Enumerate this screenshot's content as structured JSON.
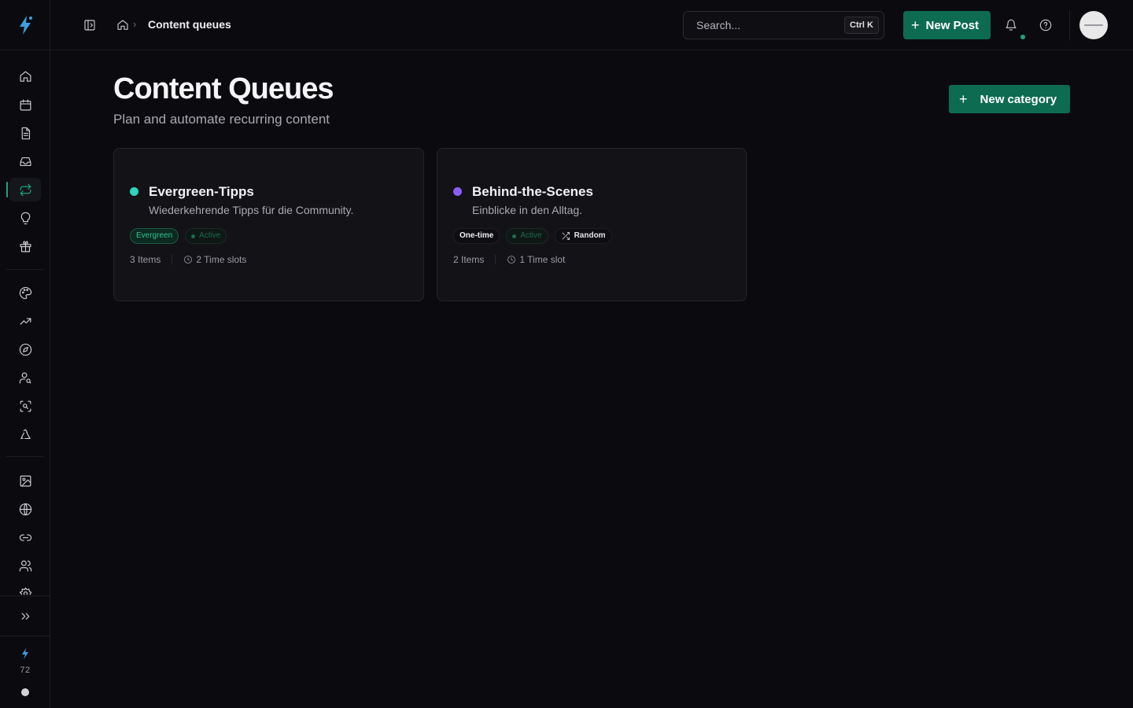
{
  "app": {
    "logo_icon": "lightning-bolt-icon",
    "accent": "#1ea37a",
    "button_color": "#0d6b52"
  },
  "header": {
    "breadcrumb_current": "Content queues",
    "search_placeholder": "Search...",
    "search_shortcut": "Ctrl K",
    "new_post_label": "New Post"
  },
  "sidebar": {
    "items": [
      {
        "icon": "home-icon"
      },
      {
        "icon": "calendar-icon"
      },
      {
        "icon": "document-icon"
      },
      {
        "icon": "inbox-icon"
      },
      {
        "icon": "repeat-icon",
        "active": true
      },
      {
        "icon": "lightbulb-icon"
      },
      {
        "icon": "gift-icon"
      },
      {
        "icon": "palette-icon"
      },
      {
        "icon": "trending-up-icon"
      },
      {
        "icon": "compass-icon"
      },
      {
        "icon": "user-search-icon"
      },
      {
        "icon": "scan-search-icon"
      },
      {
        "icon": "recycle-icon"
      },
      {
        "icon": "image-icon"
      },
      {
        "icon": "globe-icon"
      },
      {
        "icon": "link-icon"
      },
      {
        "icon": "users-icon"
      },
      {
        "icon": "settings-icon"
      }
    ],
    "expand_icon": "chevrons-right-icon",
    "credits": "72"
  },
  "main": {
    "title": "Content Queues",
    "subtitle": "Plan and automate recurring content",
    "new_category_label": "New category",
    "cards": [
      {
        "title": "Evergreen-Tipps",
        "description": "Wiederkehrende Tipps für die Community.",
        "dot_color": "#2dd4bf",
        "type_badge": "Evergreen",
        "status_badge": "Active",
        "items": "3 Items",
        "time_slots": "2 Time slots"
      },
      {
        "title": "Behind-the-Scenes",
        "description": "Einblicke in den Alltag.",
        "dot_color": "#8b5cf6",
        "type_badge": "One-time",
        "status_badge": "Active",
        "order_badge": "Random",
        "items": "2 Items",
        "time_slots": "1 Time slot"
      }
    ]
  }
}
